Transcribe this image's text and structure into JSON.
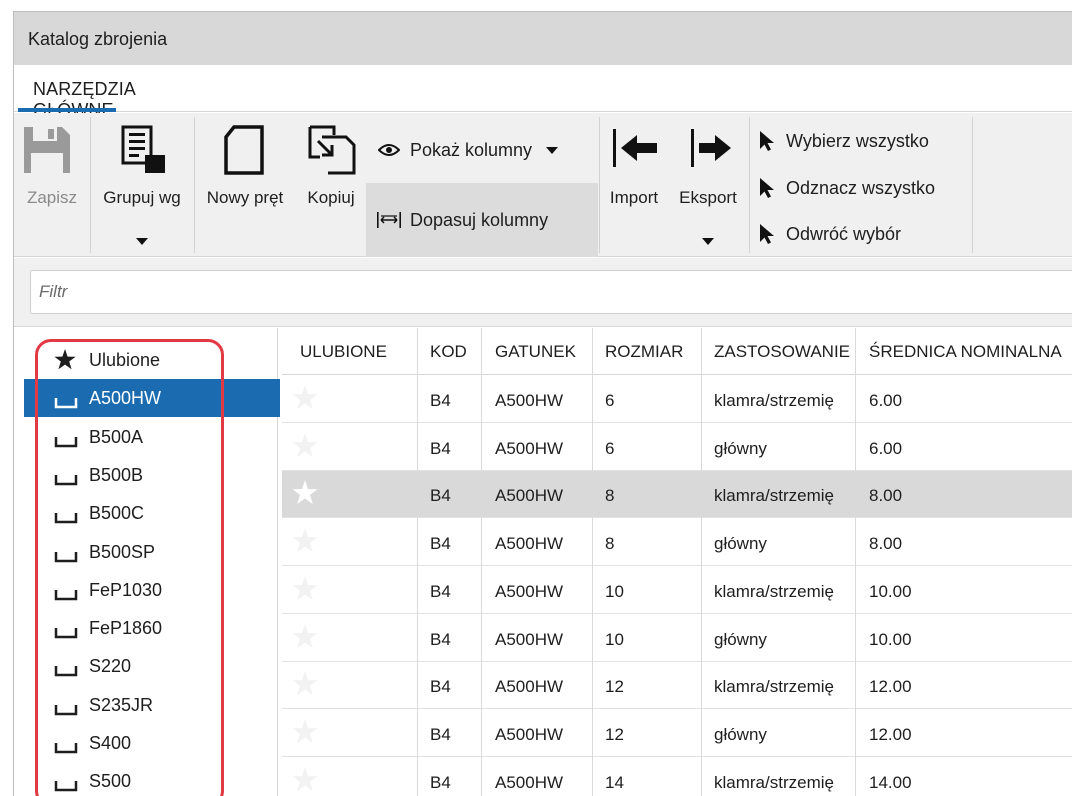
{
  "window": {
    "title": "Katalog zbrojenia"
  },
  "tabs": [
    {
      "label": "NARZĘDZIA GŁÓWNE",
      "active": true
    }
  ],
  "ribbon": {
    "save": "Zapisz",
    "group_by": "Grupuj wg",
    "new_bar": "Nowy pręt",
    "copy": "Kopiuj",
    "show_columns": "Pokaż kolumny",
    "fit_columns": "Dopasuj kolumny",
    "import": "Import",
    "export": "Eksport",
    "select_all": "Wybierz wszystko",
    "deselect_all": "Odznacz wszystko",
    "invert_selection": "Odwróć wybór"
  },
  "filter": {
    "placeholder": "Filtr",
    "value": ""
  },
  "tree": {
    "items": [
      {
        "label": "Ulubione",
        "icon": "star-icon"
      },
      {
        "label": "A500HW",
        "icon": "tray-icon",
        "selected": true
      },
      {
        "label": "B500A",
        "icon": "tray-icon"
      },
      {
        "label": "B500B",
        "icon": "tray-icon"
      },
      {
        "label": "B500C",
        "icon": "tray-icon"
      },
      {
        "label": "B500SP",
        "icon": "tray-icon"
      },
      {
        "label": "FeP1030",
        "icon": "tray-icon"
      },
      {
        "label": "FeP1860",
        "icon": "tray-icon"
      },
      {
        "label": "S220",
        "icon": "tray-icon"
      },
      {
        "label": "S235JR",
        "icon": "tray-icon"
      },
      {
        "label": "S400",
        "icon": "tray-icon"
      },
      {
        "label": "S500",
        "icon": "tray-icon"
      }
    ]
  },
  "table": {
    "columns": [
      "ULUBIONE",
      "KOD",
      "GATUNEK",
      "ROZMIAR",
      "ZASTOSOWANIE",
      "ŚREDNICA NOMINALNA"
    ],
    "rows": [
      {
        "kod": "B4",
        "gatunek": "A500HW",
        "rozmiar": "6",
        "zastosowanie": "klamra/strzemię",
        "srednica": "6.00"
      },
      {
        "kod": "B4",
        "gatunek": "A500HW",
        "rozmiar": "6",
        "zastosowanie": "główny",
        "srednica": "6.00"
      },
      {
        "kod": "B4",
        "gatunek": "A500HW",
        "rozmiar": "8",
        "zastosowanie": "klamra/strzemię",
        "srednica": "8.00",
        "selected": true
      },
      {
        "kod": "B4",
        "gatunek": "A500HW",
        "rozmiar": "8",
        "zastosowanie": "główny",
        "srednica": "8.00"
      },
      {
        "kod": "B4",
        "gatunek": "A500HW",
        "rozmiar": "10",
        "zastosowanie": "klamra/strzemię",
        "srednica": "10.00"
      },
      {
        "kod": "B4",
        "gatunek": "A500HW",
        "rozmiar": "10",
        "zastosowanie": "główny",
        "srednica": "10.00"
      },
      {
        "kod": "B4",
        "gatunek": "A500HW",
        "rozmiar": "12",
        "zastosowanie": "klamra/strzemię",
        "srednica": "12.00"
      },
      {
        "kod": "B4",
        "gatunek": "A500HW",
        "rozmiar": "12",
        "zastosowanie": "główny",
        "srednica": "12.00"
      },
      {
        "kod": "B4",
        "gatunek": "A500HW",
        "rozmiar": "14",
        "zastosowanie": "klamra/strzemię",
        "srednica": "14.00"
      }
    ]
  },
  "colors": {
    "accent": "#1a6bb0",
    "highlight_outline": "#e23a44",
    "selected_row": "#d9d9d9"
  }
}
